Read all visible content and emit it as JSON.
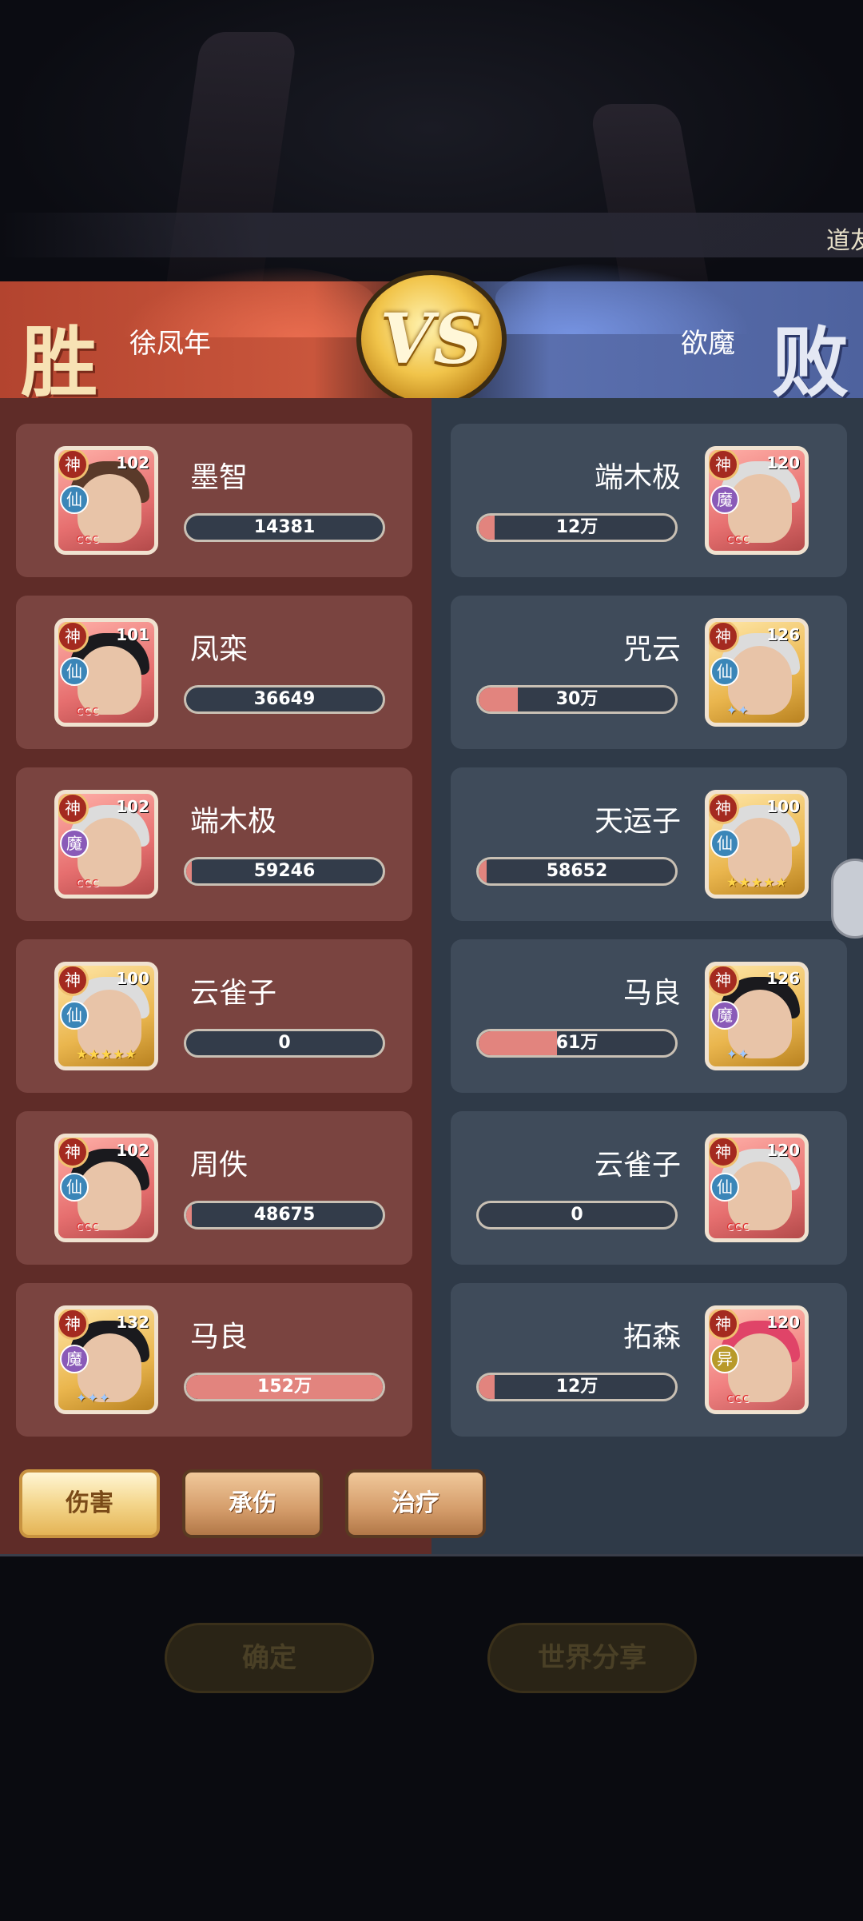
{
  "ticker": "道友",
  "header": {
    "win_char": "胜",
    "lose_char": "败",
    "winner_name": "徐凤年",
    "loser_name": "欲魔",
    "vs_label": "VS"
  },
  "left_heroes": [
    {
      "name": "墨智",
      "level": "102",
      "grade": "神",
      "race": "仙",
      "race_type": "xian",
      "value": "14381",
      "fill": 0.0,
      "marks": "ccc",
      "marks_style": "red",
      "portrait": "red",
      "hair": "brown"
    },
    {
      "name": "凤栾",
      "level": "101",
      "grade": "神",
      "race": "仙",
      "race_type": "xian",
      "value": "36649",
      "fill": 0.0,
      "marks": "ccc",
      "marks_style": "red",
      "portrait": "red",
      "hair": "black"
    },
    {
      "name": "端木极",
      "level": "102",
      "grade": "神",
      "race": "魔",
      "race_type": "mo",
      "value": "59246",
      "fill": 0.03,
      "marks": "ccc",
      "marks_style": "red",
      "portrait": "red",
      "hair": "white"
    },
    {
      "name": "云雀子",
      "level": "100",
      "grade": "神",
      "race": "仙",
      "race_type": "xian",
      "value": "0",
      "fill": 0.0,
      "marks": "★★★★★",
      "marks_style": "gold",
      "portrait": "gold",
      "hair": "white"
    },
    {
      "name": "周佚",
      "level": "102",
      "grade": "神",
      "race": "仙",
      "race_type": "xian",
      "value": "48675",
      "fill": 0.03,
      "marks": "ccc",
      "marks_style": "red",
      "portrait": "red",
      "hair": "black"
    },
    {
      "name": "马良",
      "level": "132",
      "grade": "神",
      "race": "魔",
      "race_type": "mo",
      "value": "152万",
      "fill": 1.0,
      "marks": "✦✦✦",
      "marks_style": "blue",
      "portrait": "gold",
      "hair": "black"
    }
  ],
  "right_heroes": [
    {
      "name": "端木极",
      "level": "120",
      "grade": "神",
      "race": "魔",
      "race_type": "mo",
      "value": "12万",
      "fill": 0.08,
      "marks": "ccc",
      "marks_style": "red",
      "portrait": "red",
      "hair": "white"
    },
    {
      "name": "咒云",
      "level": "126",
      "grade": "神",
      "race": "仙",
      "race_type": "xian",
      "value": "30万",
      "fill": 0.2,
      "marks": "✦✦",
      "marks_style": "blue",
      "portrait": "gold",
      "hair": "white"
    },
    {
      "name": "天运子",
      "level": "100",
      "grade": "神",
      "race": "仙",
      "race_type": "xian",
      "value": "58652",
      "fill": 0.04,
      "marks": "★★★★★",
      "marks_style": "gold",
      "portrait": "gold",
      "hair": "white"
    },
    {
      "name": "马良",
      "level": "126",
      "grade": "神",
      "race": "魔",
      "race_type": "mo",
      "value": "61万",
      "fill": 0.4,
      "marks": "✦✦",
      "marks_style": "blue",
      "portrait": "gold",
      "hair": "black"
    },
    {
      "name": "云雀子",
      "level": "120",
      "grade": "神",
      "race": "仙",
      "race_type": "xian",
      "value": "0",
      "fill": 0.0,
      "marks": "ccc",
      "marks_style": "red",
      "portrait": "red",
      "hair": "white"
    },
    {
      "name": "拓森",
      "level": "120",
      "grade": "神",
      "race": "异",
      "race_type": "yi",
      "value": "12万",
      "fill": 0.08,
      "marks": "ccc",
      "marks_style": "red",
      "portrait": "pink",
      "hair": "pinkh"
    }
  ],
  "tabs": {
    "damage": "伤害",
    "taken": "承伤",
    "heal": "治疗"
  },
  "buttons": {
    "confirm": "确定",
    "share": "世界分享"
  }
}
